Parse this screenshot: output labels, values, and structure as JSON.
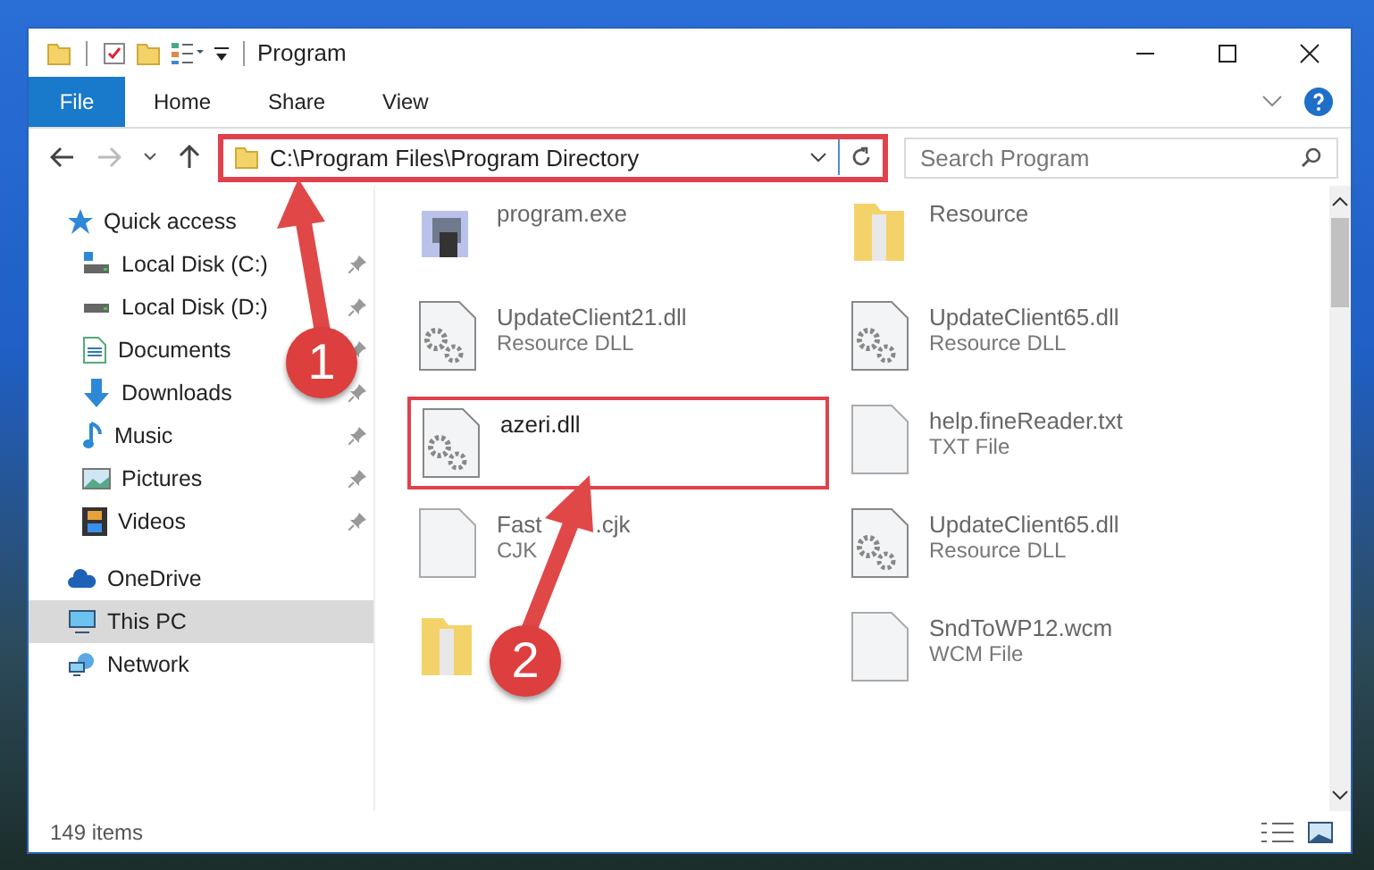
{
  "window": {
    "title": "Program"
  },
  "ribbon_tabs": [
    {
      "label": "File",
      "selected": true
    },
    {
      "label": "Home",
      "selected": false
    },
    {
      "label": "Share",
      "selected": false
    },
    {
      "label": "View",
      "selected": false
    }
  ],
  "address": {
    "path": "C:\\Program Files\\Program Directory",
    "highlighted": true
  },
  "search": {
    "placeholder": "Search Program"
  },
  "sidebar": {
    "items": [
      {
        "label": "Quick access",
        "kind": "star",
        "selected": false,
        "children": [
          {
            "label": "Local Disk (C:)",
            "kind": "sysdrive",
            "pinned": true
          },
          {
            "label": "Local Disk (D:)",
            "kind": "drive",
            "pinned": true
          },
          {
            "label": "Documents",
            "kind": "documents",
            "pinned": true
          },
          {
            "label": "Downloads",
            "kind": "downloads",
            "pinned": true
          },
          {
            "label": "Music",
            "kind": "music",
            "pinned": true
          },
          {
            "label": "Pictures",
            "kind": "pictures",
            "pinned": true
          },
          {
            "label": "Videos",
            "kind": "videos",
            "pinned": true
          }
        ]
      },
      {
        "label": "OneDrive",
        "kind": "cloud",
        "selected": false
      },
      {
        "label": "This PC",
        "kind": "pc",
        "selected": true
      },
      {
        "label": "Network",
        "kind": "network",
        "selected": false
      }
    ]
  },
  "files": [
    {
      "name": "program.exe",
      "kind": "exe",
      "highlighted": false
    },
    {
      "name": "Resource",
      "kind": "folder",
      "highlighted": false
    },
    {
      "name": "UpdateClient21.dll",
      "type": "Resource DLL",
      "kind": "dll",
      "highlighted": false
    },
    {
      "name": "UpdateClient65.dll",
      "type": "Resource DLL",
      "kind": "dll",
      "highlighted": false
    },
    {
      "name": "azeri.dll",
      "kind": "dll",
      "highlighted": true
    },
    {
      "name": "help.fineReader.txt",
      "type": "TXT File",
      "kind": "txt",
      "highlighted": false
    },
    {
      "name": "Fast",
      "name_end": ".cjk",
      "type": "CJK",
      "kind": "txt",
      "highlighted": false
    },
    {
      "name": "UpdateClient65.dll",
      "type": "Resource DLL",
      "kind": "dll",
      "highlighted": false
    },
    {
      "kind": "folder",
      "highlighted": false
    },
    {
      "name": "SndToWP12.wcm",
      "type": "WCM File",
      "kind": "txt",
      "highlighted": false
    }
  ],
  "status_bar": {
    "count": "149 items"
  },
  "annotations": [
    {
      "number": "1"
    },
    {
      "number": "2"
    }
  ]
}
